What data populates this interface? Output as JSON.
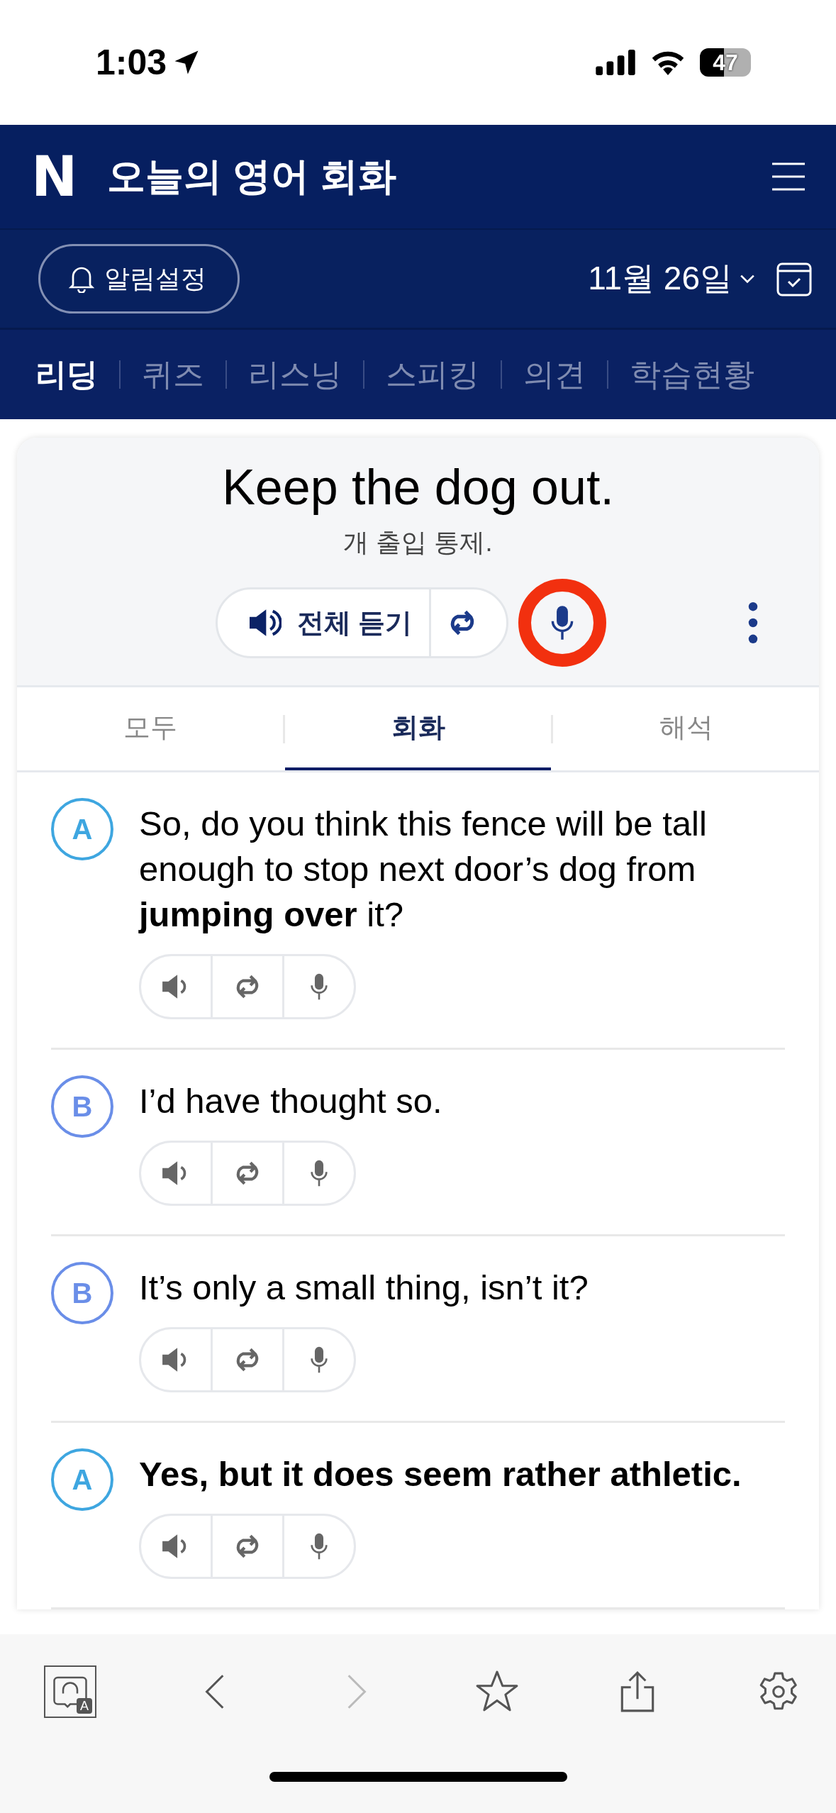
{
  "status_bar": {
    "time": "1:03",
    "battery": "47"
  },
  "header": {
    "logo": "N",
    "title": "오늘의 영어 회화"
  },
  "toolbar": {
    "alarm_button": "알림설정",
    "date": "11월 26일"
  },
  "nav_tabs": [
    {
      "label": "리딩",
      "selected": true
    },
    {
      "label": "퀴즈",
      "selected": false
    },
    {
      "label": "리스닝",
      "selected": false
    },
    {
      "label": "스피킹",
      "selected": false
    },
    {
      "label": "의견",
      "selected": false
    },
    {
      "label": "학습현황",
      "selected": false
    }
  ],
  "lesson": {
    "title": "Keep the dog out.",
    "translation": "개 출입 통제.",
    "listen_all_button": "전체 듣기",
    "mic_active": true
  },
  "view_tabs": [
    {
      "label": "모두",
      "selected": false
    },
    {
      "label": "회화",
      "selected": true
    },
    {
      "label": "해석",
      "selected": false
    }
  ],
  "dialogue": [
    {
      "speaker": "A",
      "color": "#3ea6e0",
      "text": "So, do you think this fence will be tall enough to stop next door’s dog from **jumping over** it?",
      "bold": false
    },
    {
      "speaker": "B",
      "color": "#6a8ee8",
      "text": "I’d have thought so.",
      "bold": false
    },
    {
      "speaker": "B",
      "color": "#6a8ee8",
      "text": "It’s only a small thing, isn’t it?",
      "bold": false
    },
    {
      "speaker": "A",
      "color": "#3ea6e0",
      "text": "Yes, but it does seem rather athletic.",
      "bold": true
    }
  ],
  "bottom_bar": {
    "app_icon_badge": "A",
    "forward_disabled": true
  }
}
